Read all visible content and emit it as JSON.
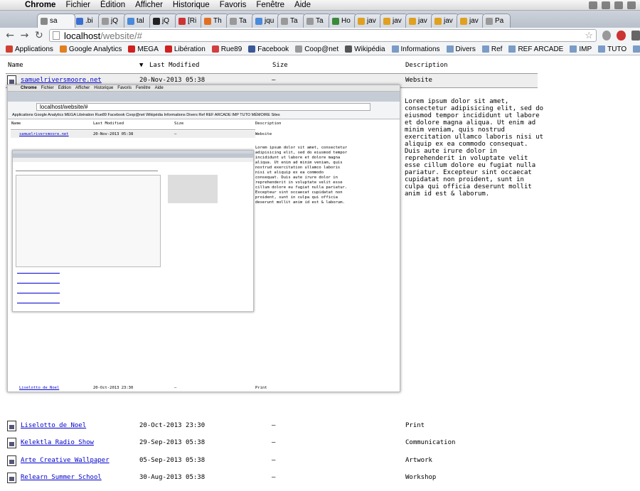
{
  "menubar": {
    "app": "Chrome",
    "items": [
      "Fichier",
      "Édition",
      "Afficher",
      "Historique",
      "Favoris",
      "Fenêtre",
      "Aide"
    ]
  },
  "tabs": [
    {
      "label": "sa",
      "color": "#888",
      "active": true
    },
    {
      "label": ".bi",
      "color": "#3a6fd0"
    },
    {
      "label": "jQ",
      "color": "#999"
    },
    {
      "label": "tal",
      "color": "#4a8ad8"
    },
    {
      "label": "jQ",
      "color": "#222"
    },
    {
      "label": "[Ri",
      "color": "#c33"
    },
    {
      "label": "Th",
      "color": "#e07020"
    },
    {
      "label": "Ta",
      "color": "#999"
    },
    {
      "label": "jqu",
      "color": "#4a8ad8"
    },
    {
      "label": "Ta",
      "color": "#999"
    },
    {
      "label": "Ta",
      "color": "#999"
    },
    {
      "label": "Ho",
      "color": "#3a8a3a"
    },
    {
      "label": "jav",
      "color": "#e0a020"
    },
    {
      "label": "jav",
      "color": "#e0a020"
    },
    {
      "label": "jav",
      "color": "#e0a020"
    },
    {
      "label": "jav",
      "color": "#e0a020"
    },
    {
      "label": "jav",
      "color": "#e0a020"
    },
    {
      "label": "Pa",
      "color": "#999"
    }
  ],
  "toolbar": {
    "url_host": "localhost",
    "url_path": "/website/#"
  },
  "bookmarks": [
    {
      "label": "Applications",
      "color": "#d04030"
    },
    {
      "label": "Google Analytics",
      "color": "#e08020"
    },
    {
      "label": "MEGA",
      "color": "#d02020"
    },
    {
      "label": "Libération",
      "color": "#d02020"
    },
    {
      "label": "Rue89",
      "color": "#d04040"
    },
    {
      "label": "Facebook",
      "color": "#3b5998"
    },
    {
      "label": "Coop@net",
      "color": "#999"
    },
    {
      "label": "Wikipédia",
      "color": "#555"
    },
    {
      "label": "Informations",
      "folder": true
    },
    {
      "label": "Divers",
      "folder": true
    },
    {
      "label": "Ref",
      "folder": true
    },
    {
      "label": "REF ARCADE",
      "folder": true
    },
    {
      "label": "IMP",
      "folder": true
    },
    {
      "label": "TUTO",
      "folder": true
    },
    {
      "label": "MÉMOIRE",
      "folder": true
    },
    {
      "label": "Sites",
      "folder": true
    }
  ],
  "table": {
    "headers": {
      "name": "Name",
      "modified": "Last Modified",
      "size": "Size",
      "description": "Description"
    },
    "sort_arrow": "▼",
    "rows": [
      {
        "name": "samuelriversmoore.net",
        "modified": "20-Nov-2013 05:38",
        "size": "—",
        "description": "Website"
      },
      {
        "name": "Liselotto de Noel",
        "modified": "20-Oct-2013 23:30",
        "size": "—",
        "description": "Print"
      },
      {
        "name": "Kelektla Radio Show",
        "modified": "29-Sep-2013 05:38",
        "size": "—",
        "description": "Communication"
      },
      {
        "name": "Arte Creative Wallpaper",
        "modified": "05-Sep-2013 05:38",
        "size": "—",
        "description": "Artwork"
      },
      {
        "name": "Relearn Summer School",
        "modified": "30-Aug-2013 05:38",
        "size": "—",
        "description": "Workshop"
      }
    ]
  },
  "description_text": "Lorem ipsum dolor sit amet, consectetur adipisicing elit, sed do eiusmod tempor incididunt ut labore et dolore magna aliqua. Ut enim ad minim veniam, quis nostrud exercitation ullamco laboris nisi ut aliquip ex ea commodo consequat. Duis aute irure dolor in reprehenderit in voluptate velit esse cillum dolore eu fugiat nulla pariatur. Excepteur sint occaecat cupidatat non proident, sunt in culpa qui officia deserunt mollit anim id est & laborum.",
  "preview": {
    "url": "localhost/website/#",
    "bookmarks_line": "Applications  Google Analytics  MEGA  Libération  Rue89  Facebook  Coop@net  Wikipédia  Informations  Divers  Ref  REF ARCADE  IMP  TUTO  MÉMOIRE  Sites"
  }
}
